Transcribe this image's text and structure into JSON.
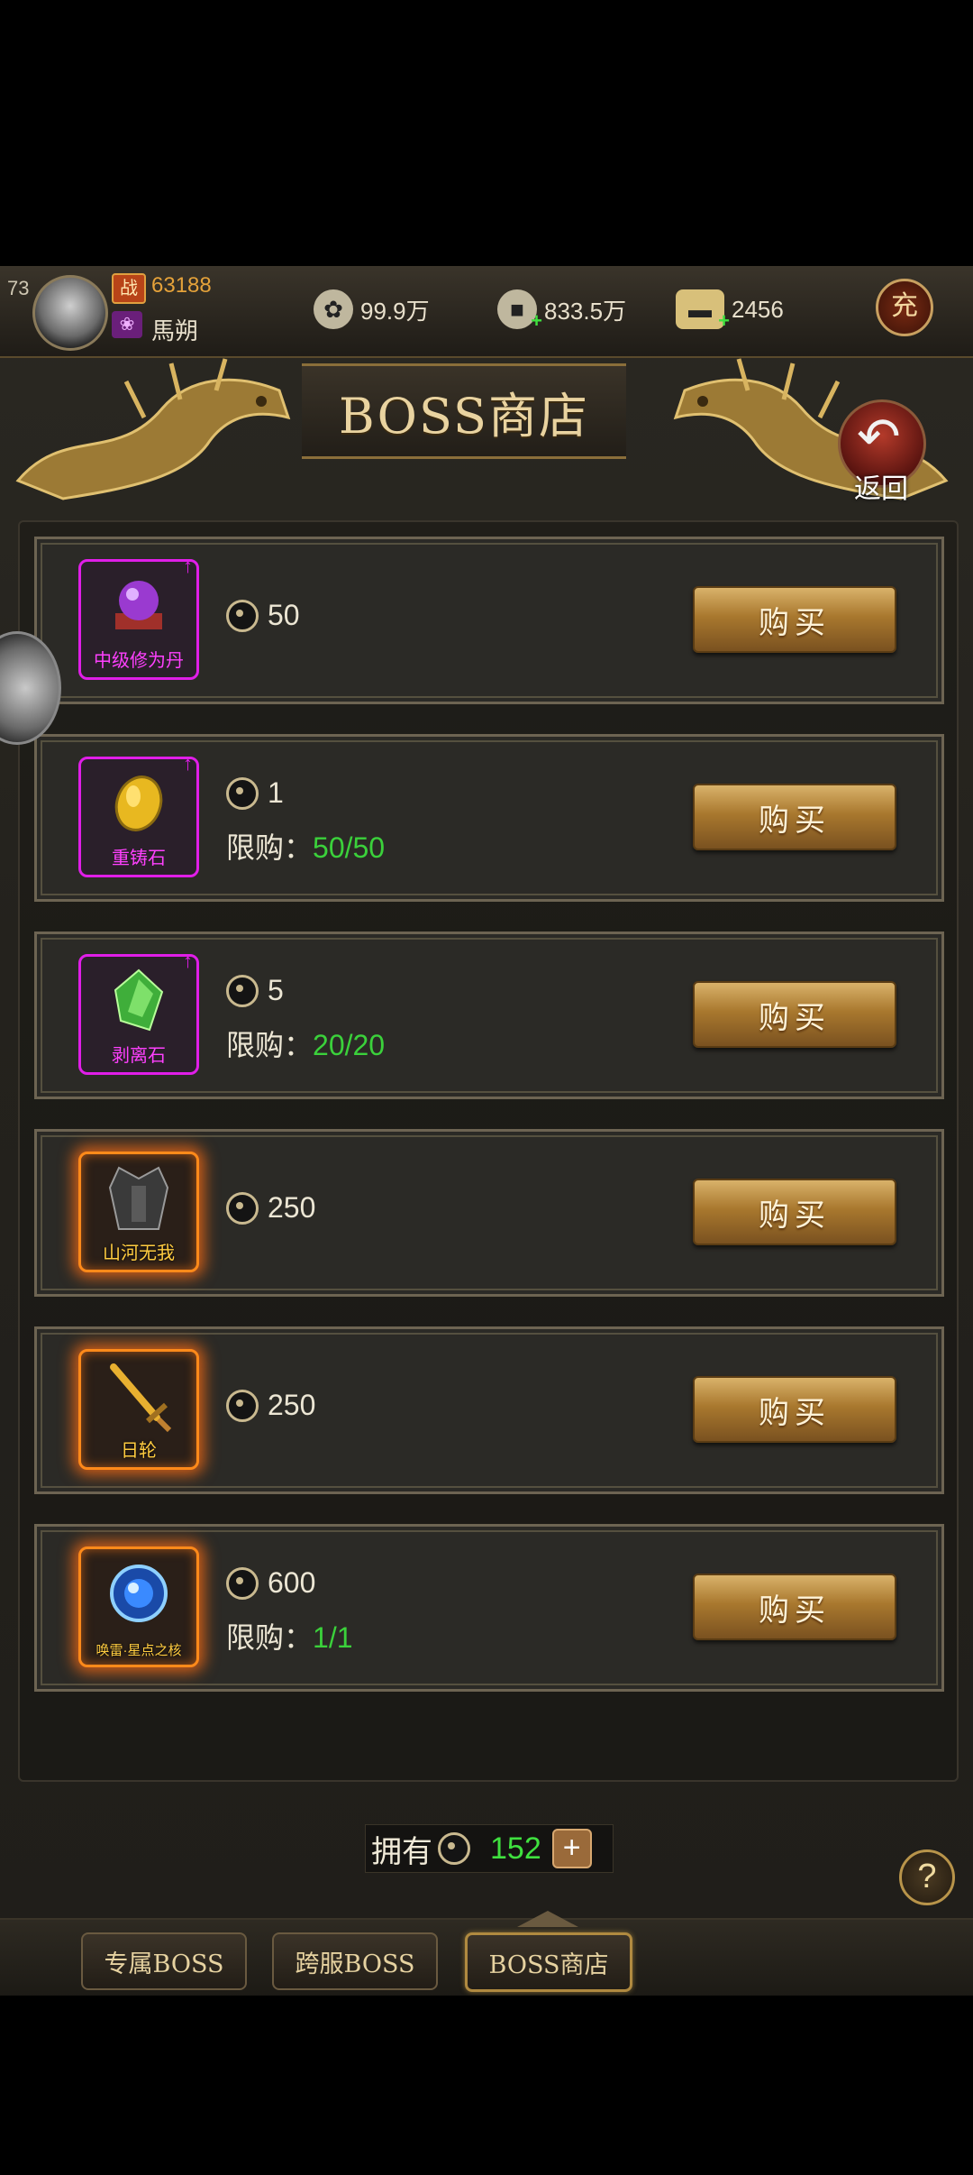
{
  "topbar": {
    "level": "73",
    "power_icon": "战",
    "power": "63188",
    "guild_icon": "lotus-icon",
    "player_name": "馬朔",
    "currencies": [
      {
        "icon": "ingot-bag-icon",
        "value": "99.9万",
        "color": "#c8c0a8"
      },
      {
        "icon": "copper-coin-icon",
        "value": "833.5万",
        "color": "#c8c0a8"
      },
      {
        "icon": "gold-ingot-icon",
        "value": "2456",
        "color": "#d8c07a"
      }
    ],
    "recharge_label": "充"
  },
  "header": {
    "title": "BOSS商店",
    "back_label": "返回"
  },
  "items": [
    {
      "name": "中级修为丹",
      "price": "50",
      "limit_label": "",
      "limit": "",
      "frame": "purple",
      "buy_label": "购买"
    },
    {
      "name": "重铸石",
      "price": "1",
      "limit_label": "限购：",
      "limit": "50/50",
      "frame": "purple",
      "buy_label": "购买"
    },
    {
      "name": "剥离石",
      "price": "5",
      "limit_label": "限购：",
      "limit": "20/20",
      "frame": "purple",
      "buy_label": "购买"
    },
    {
      "name": "山河无我",
      "price": "250",
      "limit_label": "",
      "limit": "",
      "frame": "orange",
      "buy_label": "购买"
    },
    {
      "name": "日轮",
      "price": "250",
      "limit_label": "",
      "limit": "",
      "frame": "orange",
      "buy_label": "购买"
    },
    {
      "name": "唤雷·星点之核",
      "price": "600",
      "limit_label": "限购：",
      "limit": "1/1",
      "frame": "orange",
      "buy_label": "购买"
    }
  ],
  "owned": {
    "label": "拥有",
    "value": "152",
    "add_label": "+"
  },
  "help_label": "?",
  "tabs": [
    {
      "label": "专属BOSS",
      "active": false
    },
    {
      "label": "跨服BOSS",
      "active": false
    },
    {
      "label": "BOSS商店",
      "active": true
    }
  ]
}
